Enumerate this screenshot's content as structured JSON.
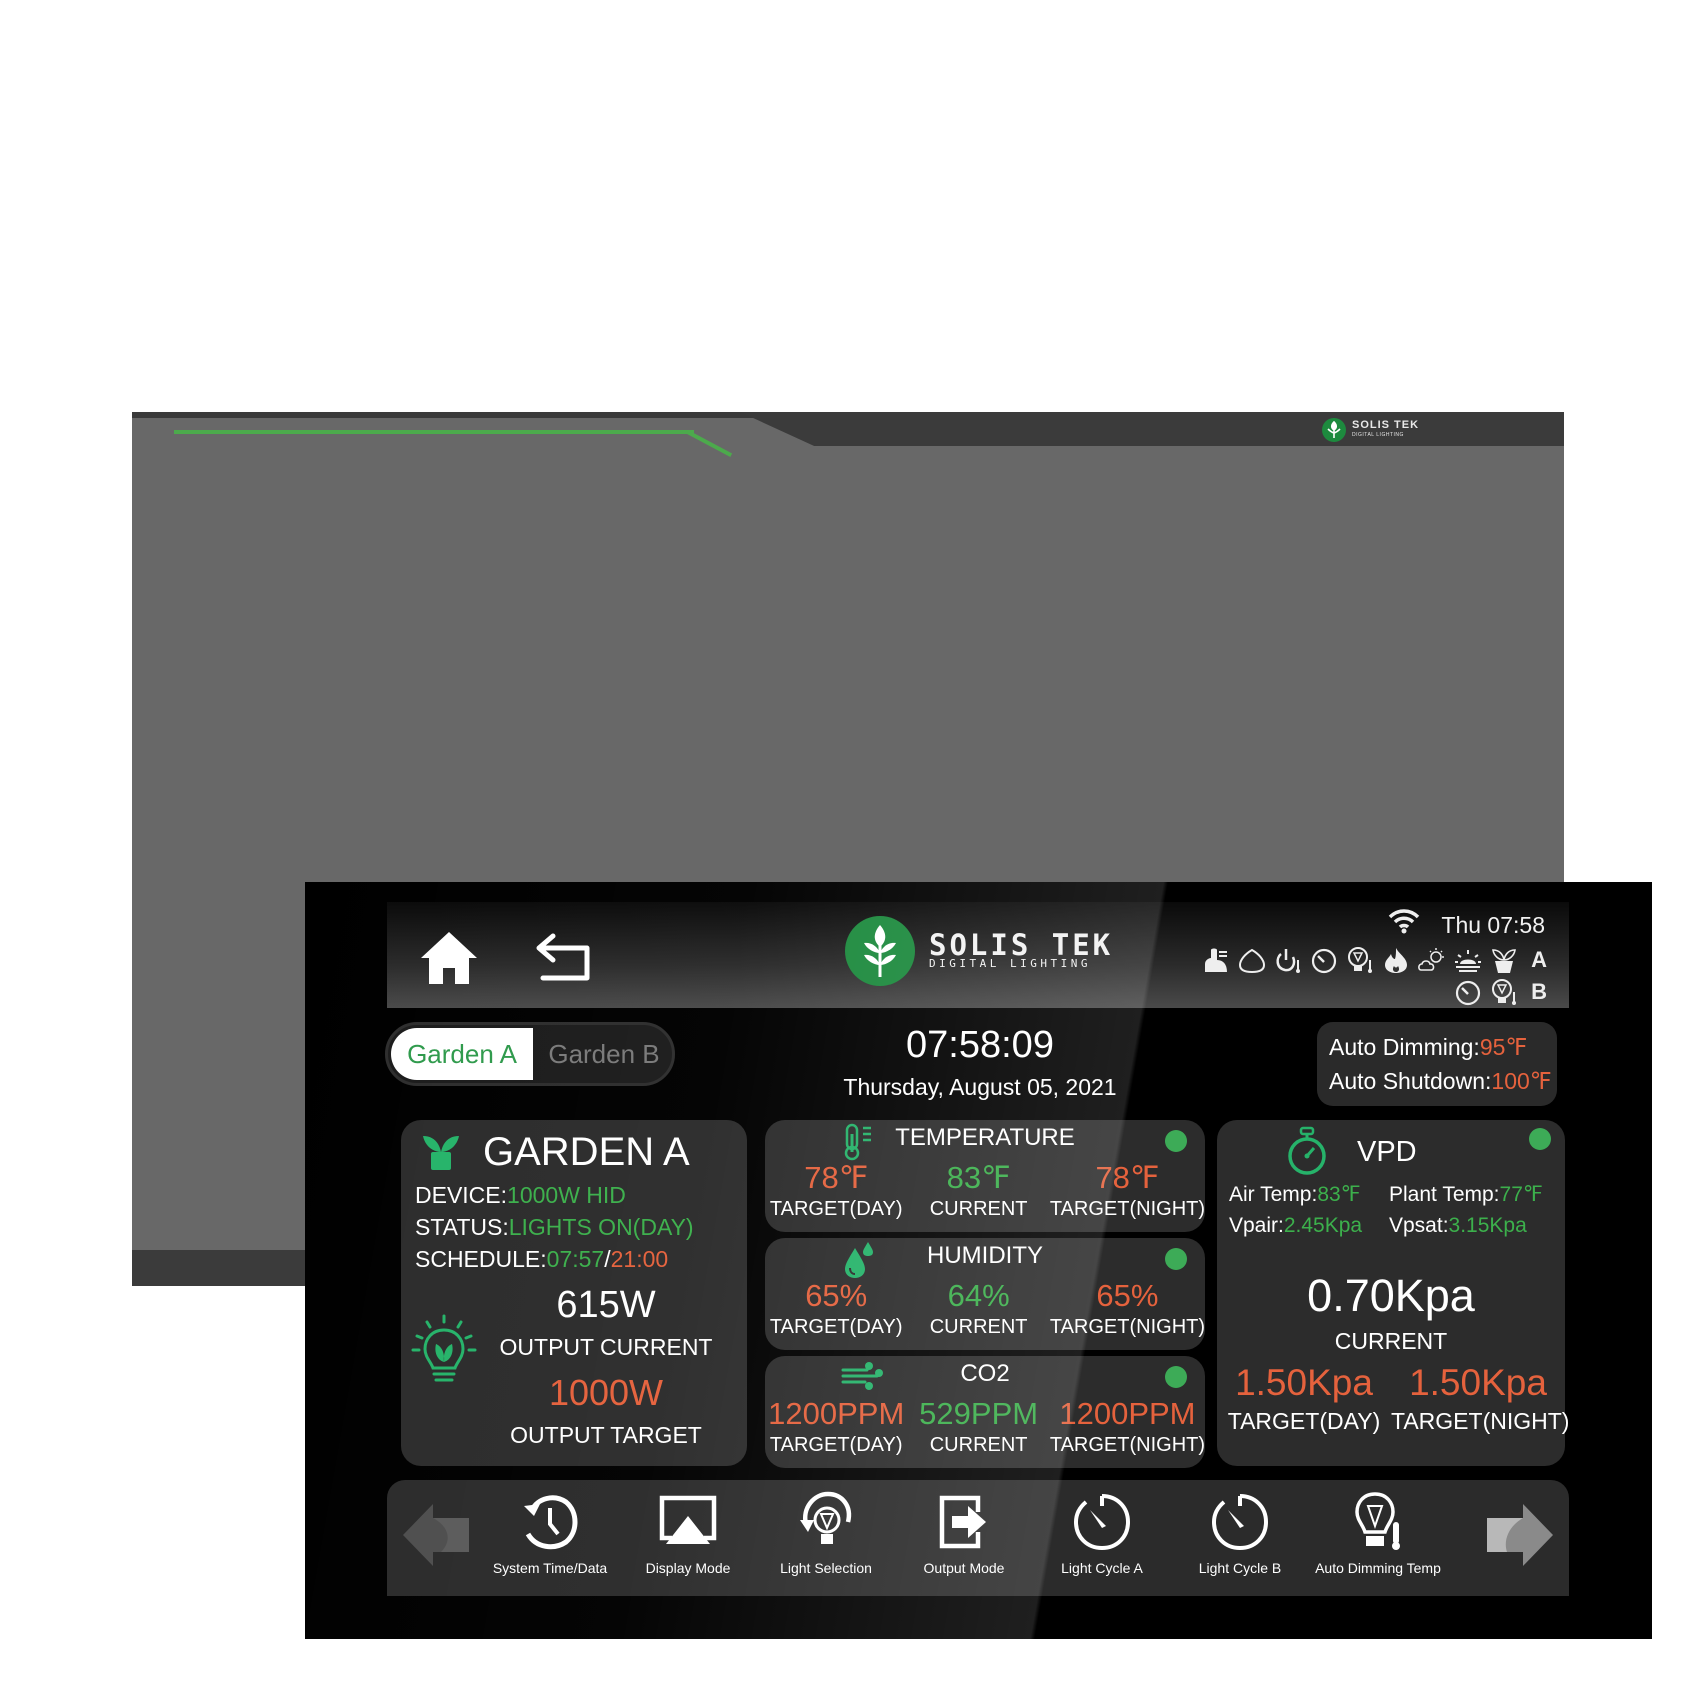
{
  "brand": {
    "name": "SOLIS TEK",
    "tagline": "DIGITAL LIGHTING"
  },
  "colors": {
    "accent_green": "#3cb04c",
    "target_red": "#e5623d",
    "card_bg": "#2c2c2c",
    "logo_green": "#1d8a3e"
  },
  "header": {
    "home_icon": "home-icon",
    "back_icon": "back-arrow-icon",
    "status_time": "Thu 07:58",
    "status_icons_a": [
      "ventilation-icon",
      "humidity-drop-icon",
      "power-temp-icon",
      "timer-icon",
      "light-temp-icon",
      "fire-icon",
      "cloud-sun-icon",
      "sunrise-icon",
      "plant-pot-icon"
    ],
    "row_a_label": "A",
    "status_icons_b": [
      "timer-icon",
      "light-temp-icon"
    ],
    "row_b_label": "B"
  },
  "garden_toggle": {
    "options": [
      "Garden A",
      "Garden B"
    ],
    "selected": "Garden A"
  },
  "clock": {
    "time": "07:58:09",
    "date": "Thursday, August 05, 2021"
  },
  "auto": {
    "dimming_label": "Auto Dimming:",
    "dimming_value": "95℉",
    "shutdown_label": "Auto Shutdown:",
    "shutdown_value": "100℉"
  },
  "garden_card": {
    "title": "GARDEN A",
    "device_label": "DEVICE:",
    "device_value": "1000W HID",
    "status_label": "STATUS:",
    "status_value": "LIGHTS ON(DAY)",
    "schedule_label": "SCHEDULE:",
    "schedule_on": "07:57",
    "schedule_sep": "/",
    "schedule_off": "21:00",
    "output_current_value": "615W",
    "output_current_label": "OUTPUT CURRENT",
    "output_target_value": "1000W",
    "output_target_label": "OUTPUT TARGET"
  },
  "sensors": [
    {
      "title": "TEMPERATURE",
      "icon": "thermometer-icon",
      "status": "ok",
      "values": [
        {
          "value": "78℉",
          "label": "TARGET(DAY)",
          "kind": "target"
        },
        {
          "value": "83℉",
          "label": "CURRENT",
          "kind": "current"
        },
        {
          "value": "78℉",
          "label": "TARGET(NIGHT)",
          "kind": "target"
        }
      ]
    },
    {
      "title": "HUMIDITY",
      "icon": "water-drops-icon",
      "status": "ok",
      "values": [
        {
          "value": "65%",
          "label": "TARGET(DAY)",
          "kind": "target"
        },
        {
          "value": "64%",
          "label": "CURRENT",
          "kind": "current"
        },
        {
          "value": "65%",
          "label": "TARGET(NIGHT)",
          "kind": "target"
        }
      ]
    },
    {
      "title": "CO2",
      "icon": "wind-icon",
      "status": "ok",
      "values": [
        {
          "value": "1200PPM",
          "label": "TARGET(DAY)",
          "kind": "target"
        },
        {
          "value": "529PPM",
          "label": "CURRENT",
          "kind": "current"
        },
        {
          "value": "1200PPM",
          "label": "TARGET(NIGHT)",
          "kind": "target"
        }
      ]
    }
  ],
  "vpd": {
    "title": "VPD",
    "air_temp_label": "Air Temp:",
    "air_temp_value": "83℉",
    "plant_temp_label": "Plant Temp:",
    "plant_temp_value": "77℉",
    "vpair_label": "Vpair:",
    "vpair_value": "2.45Kpa",
    "vpsat_label": "Vpsat:",
    "vpsat_value": "3.15Kpa",
    "current_value": "0.70Kpa",
    "current_label": "CURRENT",
    "target_day_value": "1.50Kpa",
    "target_day_label": "TARGET(DAY)",
    "target_night_value": "1.50Kpa",
    "target_night_label": "TARGET(NIGHT)"
  },
  "toolbar": {
    "prev_icon": "arrow-left-icon",
    "next_icon": "arrow-right-icon",
    "items": [
      {
        "label": "System Time/Data",
        "icon": "history-clock-icon"
      },
      {
        "label": "Display Mode",
        "icon": "airplay-icon"
      },
      {
        "label": "Light Selection",
        "icon": "bulb-rotate-icon"
      },
      {
        "label": "Output Mode",
        "icon": "output-icon"
      },
      {
        "label": "Light Cycle A",
        "icon": "timer-icon"
      },
      {
        "label": "Light Cycle B",
        "icon": "timer-icon"
      },
      {
        "label": "Auto Dimming Temp",
        "icon": "bulb-thermometer-icon"
      }
    ]
  }
}
